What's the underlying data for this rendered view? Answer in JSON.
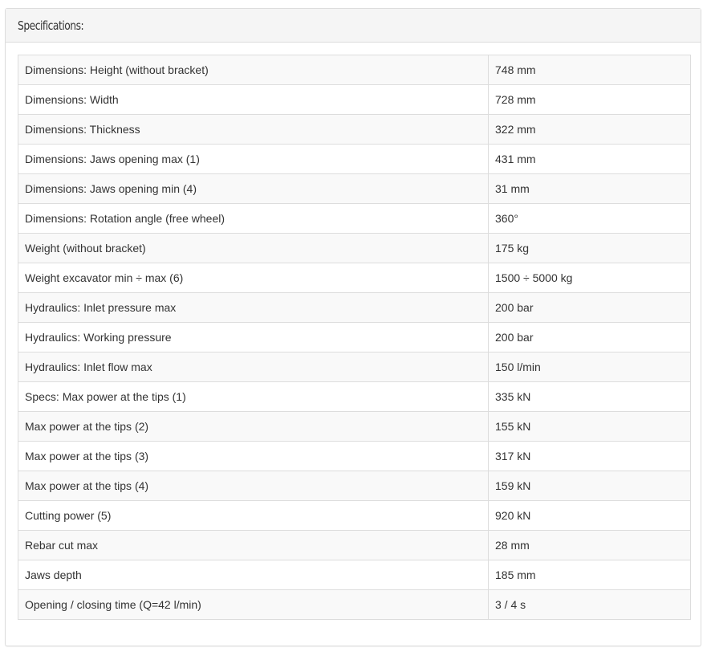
{
  "panel": {
    "title": "Specifications:"
  },
  "specs": [
    {
      "label": "Dimensions: Height (without bracket)",
      "value": "748 mm"
    },
    {
      "label": "Dimensions: Width",
      "value": "728 mm"
    },
    {
      "label": "Dimensions: Thickness",
      "value": "322 mm"
    },
    {
      "label": "Dimensions: Jaws opening max (1)",
      "value": "431 mm"
    },
    {
      "label": "Dimensions: Jaws opening min (4)",
      "value": "31 mm"
    },
    {
      "label": "Dimensions: Rotation angle (free wheel)",
      "value": "360°"
    },
    {
      "label": "Weight (without bracket)",
      "value": "175 kg"
    },
    {
      "label": "Weight excavator min ÷ max (6)",
      "value": "1500 ÷ 5000 kg"
    },
    {
      "label": "Hydraulics: Inlet pressure max",
      "value": "200 bar"
    },
    {
      "label": "Hydraulics: Working pressure",
      "value": "200 bar"
    },
    {
      "label": "Hydraulics: Inlet flow max",
      "value": "150 l/min"
    },
    {
      "label": "Specs: Max power at the tips (1)",
      "value": "335 kN"
    },
    {
      "label": "Max power at the tips (2)",
      "value": "155 kN"
    },
    {
      "label": "Max power at the tips (3)",
      "value": "317 kN"
    },
    {
      "label": "Max power at the tips (4)",
      "value": "159 kN"
    },
    {
      "label": "Cutting power (5)",
      "value": "920 kN"
    },
    {
      "label": "Rebar cut max",
      "value": "28 mm"
    },
    {
      "label": "Jaws depth",
      "value": "185 mm"
    },
    {
      "label": "Opening / closing time (Q=42 l/min)",
      "value": "3 / 4 s"
    }
  ]
}
